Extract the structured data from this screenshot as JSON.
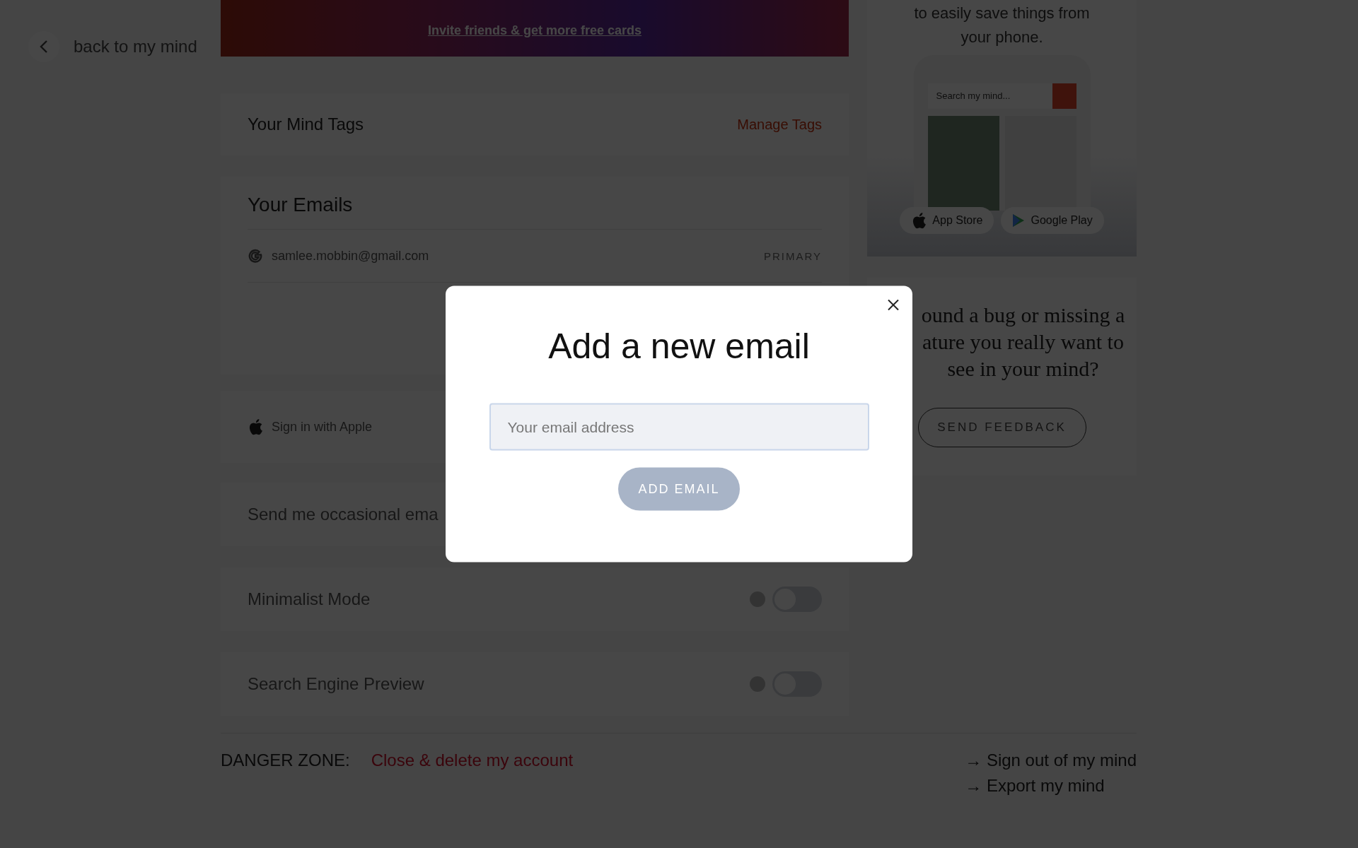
{
  "nav": {
    "back_label": "back to my mind"
  },
  "invite_banner": {
    "link": "Invite friends & get more free cards"
  },
  "tags_card": {
    "title": "Your Mind Tags",
    "action": "Manage Tags"
  },
  "emails_card": {
    "title": "Your Emails",
    "emails": [
      {
        "address": "samlee.mobbin@gmail.com",
        "badge": "PRIMARY"
      }
    ]
  },
  "apple_card": {
    "label": "Sign in with Apple"
  },
  "settings": [
    {
      "label": "Send me occasional ema",
      "kind": "text"
    },
    {
      "label": "Minimalist Mode",
      "kind": "toggle",
      "on": false
    },
    {
      "label": "Search Engine Preview",
      "kind": "toggle",
      "on": false
    }
  ],
  "danger_zone": {
    "label": "DANGER ZONE:",
    "action": "Close & delete my account"
  },
  "account_links": [
    "→ Sign out of my mind",
    "→ Export my mind"
  ],
  "app_promo": {
    "text": "to easily save things from your phone.",
    "search_placeholder": "Search my mind...",
    "stores": [
      {
        "label": "App Store",
        "kind": "apple"
      },
      {
        "label": "Google Play",
        "kind": "google"
      }
    ]
  },
  "feedback": {
    "text": "ound a bug or missing a ature you really want to see in your mind?",
    "button": "SEND FEEDBACK"
  },
  "modal": {
    "title": "Add a new email",
    "placeholder": "Your email address",
    "button": "ADD EMAIL"
  }
}
